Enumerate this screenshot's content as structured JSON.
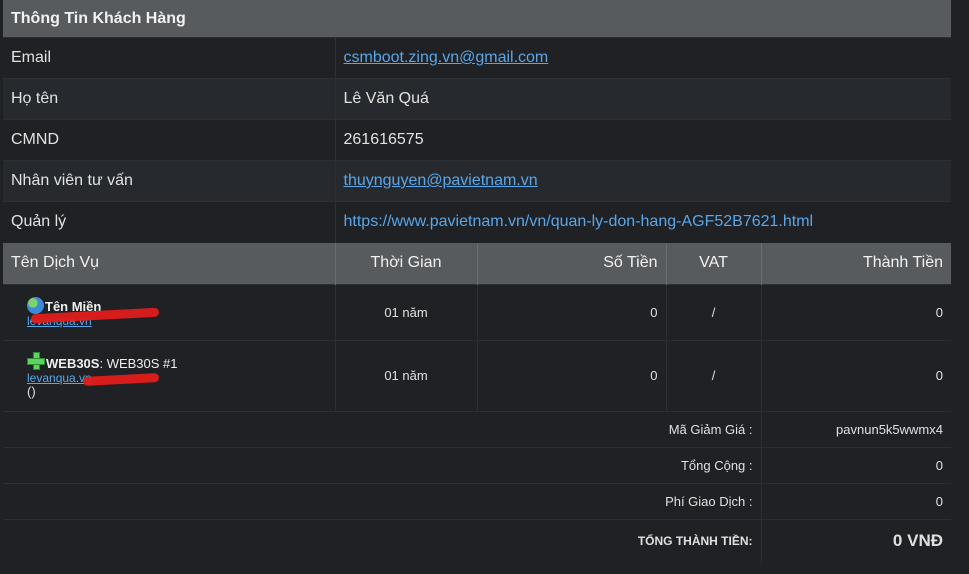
{
  "customer": {
    "header": "Thông Tin Khách Hàng",
    "rows": [
      {
        "label": "Email",
        "value": "csmboot.zing.vn@gmail.com"
      },
      {
        "label": "Họ tên",
        "value": "Lê Văn Quá"
      },
      {
        "label": "CMND",
        "value": "261616575"
      },
      {
        "label": "Nhân viên tư vấn",
        "value": "thuynguyen@pavietnam.vn"
      },
      {
        "label": "Quản lý",
        "value": "https://www.pavietnam.vn/vn/quan-ly-don-hang-AGF52B7621.html"
      }
    ]
  },
  "services": {
    "columns": [
      "Tên Dịch Vụ",
      "Thời Gian",
      "Số Tiền",
      "VAT",
      "Thành Tiền"
    ],
    "rows": [
      {
        "icon": "globe-icon",
        "name": "Tên Miền",
        "sub_link": "levanqua.vn",
        "time": "01 năm",
        "amount": "0",
        "vat": "/",
        "total": "0"
      },
      {
        "icon": "plus-icon",
        "name_bold": "WEB30S",
        "name_rest": ": WEB30S #1",
        "sub_link": "levanqua.vn",
        "extra": "()",
        "time": "01 năm",
        "amount": "0",
        "vat": "/",
        "total": "0"
      }
    ]
  },
  "summary": {
    "discount_label": "Mã Giảm Giá :",
    "discount_value": "pavnun5k5wwmx4",
    "subtotal_label": "Tổng Cộng :",
    "subtotal_value": "0",
    "fee_label": "Phí Giao Dịch :",
    "fee_value": "0",
    "grand_label": "TỔNG THÀNH TIỀN:",
    "grand_value": "0 VNĐ"
  },
  "colors": {
    "background": "#1f2124",
    "header": "#575b5e",
    "link": "#5aa6e8",
    "redaction": "#e21c1c"
  }
}
